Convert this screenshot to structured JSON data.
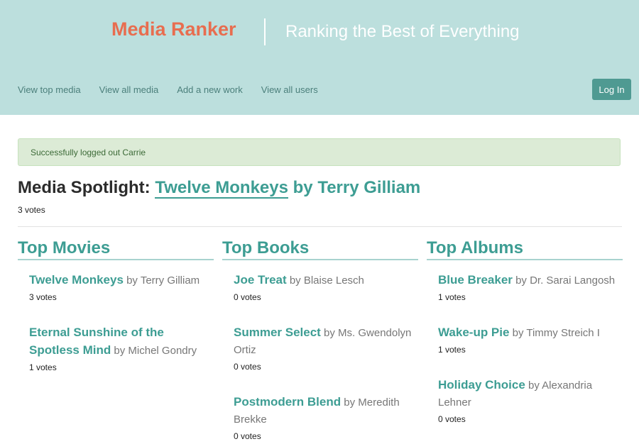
{
  "header": {
    "title": "Media Ranker",
    "tagline": "Ranking the Best of Everything",
    "nav": [
      {
        "label": "View top media"
      },
      {
        "label": "View all media"
      },
      {
        "label": "Add a new work"
      },
      {
        "label": "View all users"
      }
    ],
    "login_label": "Log In"
  },
  "flash": {
    "message": "Successfully logged out Carrie"
  },
  "spotlight": {
    "prefix": "Media Spotlight:",
    "title": "Twelve Monkeys",
    "by": "by Terry Gilliam",
    "votes": "3 votes"
  },
  "columns": [
    {
      "heading": "Top Movies",
      "items": [
        {
          "title": "Twelve Monkeys",
          "by": "by Terry Gilliam",
          "votes": "3 votes"
        },
        {
          "title": "Eternal Sunshine of the Spotless Mind",
          "by": "by Michel Gondry",
          "votes": "1 votes"
        }
      ]
    },
    {
      "heading": "Top Books",
      "items": [
        {
          "title": "Joe Treat",
          "by": "by Blaise Lesch",
          "votes": "0 votes"
        },
        {
          "title": "Summer Select",
          "by": "by Ms. Gwendolyn Ortiz",
          "votes": "0 votes"
        },
        {
          "title": "Postmodern Blend",
          "by": "by Meredith Brekke",
          "votes": "0 votes"
        }
      ]
    },
    {
      "heading": "Top Albums",
      "items": [
        {
          "title": "Blue Breaker",
          "by": "by Dr. Sarai Langosh",
          "votes": "1 votes"
        },
        {
          "title": "Wake-up Pie",
          "by": "by Timmy Streich I",
          "votes": "1 votes"
        },
        {
          "title": "Holiday Choice",
          "by": "by Alexandria Lehner",
          "votes": "0 votes"
        }
      ]
    }
  ]
}
